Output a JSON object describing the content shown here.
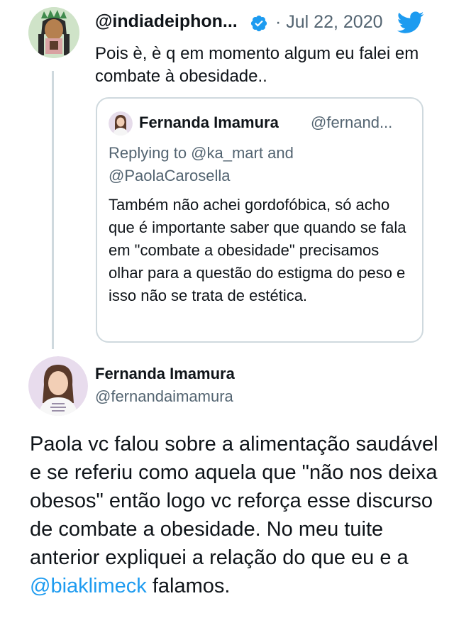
{
  "tweet": {
    "author_handle": "@indiadeiphon...",
    "separator": "·",
    "date": "Jul 22, 2020",
    "text": "Pois è, è q em momento algum eu falei em combate à obesidade..",
    "icons": {
      "verified": "verified-badge-icon",
      "brand": "twitter-bird-icon"
    },
    "colors": {
      "accent": "#1d9bf0",
      "muted": "#536471",
      "border": "#cfd9de"
    }
  },
  "quoted": {
    "name": "Fernanda Imamura",
    "handle": "@fernand...",
    "replying_to": "Replying to @ka_mart and @PaolaCarosella",
    "text": "Também não achei gordofóbica, só acho que é importante saber que quando se fala em \"combate a obesidade\" precisamos olhar para a questão do estigma do peso e isso não se trata de estética."
  },
  "main": {
    "name": "Fernanda Imamura",
    "handle": "@fernandaimamura",
    "text_before": "Paola vc falou sobre a alimentação saudável e se referiu como aquela que \"não nos deixa obesos\" então logo vc reforça esse discurso de combate a obesidade. No meu tuite anterior expliquei a relação do que eu e a ",
    "mention": "@biaklimeck",
    "text_after": " falamos."
  }
}
